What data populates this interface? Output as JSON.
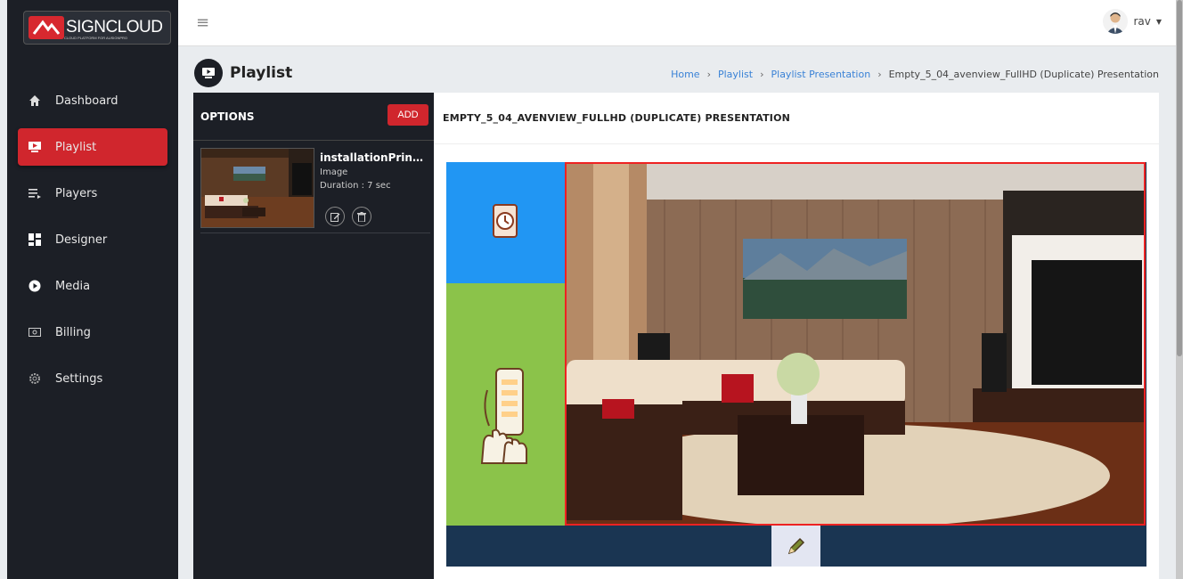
{
  "brand": {
    "name": "SIGNCLOUD",
    "tagline": "CLOUD PLATFORM FOR AUSIGNPRO"
  },
  "sidebar": {
    "items": [
      {
        "label": "Dashboard",
        "icon": "home-icon"
      },
      {
        "label": "Playlist",
        "icon": "playlist-icon",
        "active": true
      },
      {
        "label": "Players",
        "icon": "players-icon"
      },
      {
        "label": "Designer",
        "icon": "designer-icon"
      },
      {
        "label": "Media",
        "icon": "media-icon"
      },
      {
        "label": "Billing",
        "icon": "billing-icon"
      },
      {
        "label": "Settings",
        "icon": "settings-icon"
      }
    ]
  },
  "topbar": {
    "user_name": "rav",
    "menu_icon": "hamburger-icon"
  },
  "page": {
    "title": "Playlist"
  },
  "breadcrumb": {
    "home": "Home",
    "playlist": "Playlist",
    "presentation": "Playlist Presentation",
    "current": "Empty_5_04_avenview_FullHD (Duplicate) Presentation"
  },
  "options": {
    "title": "OPTIONS",
    "add_label": "ADD",
    "items": [
      {
        "name": "installationPrint...",
        "type": "Image",
        "duration": "Duration : 7 sec"
      }
    ]
  },
  "content": {
    "title": "EMPTY_5_04_AVENVIEW_FULLHD (DUPLICATE) PRESENTATION"
  },
  "colors": {
    "accent": "#d0262d",
    "sidebar": "#1c1f26",
    "zone_blue": "#2196f3",
    "zone_green": "#8bc34a",
    "zone_bottom": "#1a3552"
  }
}
